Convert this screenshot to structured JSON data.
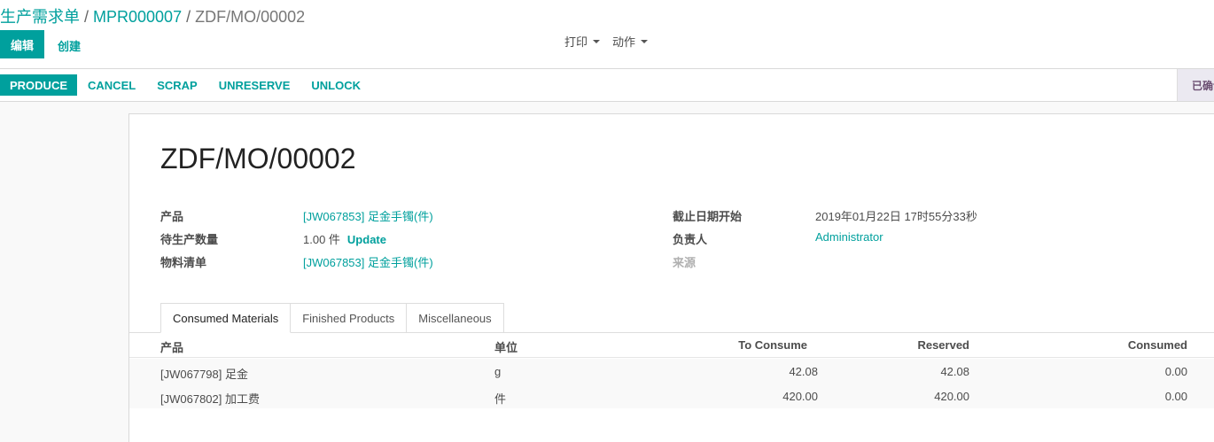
{
  "breadcrumb": {
    "root": "生产需求单",
    "parent": "MPR000007",
    "current": "ZDF/MO/00002",
    "separator": "/"
  },
  "toolbar": {
    "edit_label": "编辑",
    "create_label": "创建",
    "print_label": "打印",
    "action_label": "动作"
  },
  "statusbar": {
    "produce_label": "PRODUCE",
    "cancel_label": "CANCEL",
    "scrap_label": "SCRAP",
    "unreserve_label": "UNRESERVE",
    "unlock_label": "UNLOCK",
    "stage_label": "已确认"
  },
  "record": {
    "title": "ZDF/MO/00002",
    "product_label": "产品",
    "product_value": "[JW067853] 足金手镯(件)",
    "qty_label": "待生产数量",
    "qty_value": "1.00 件",
    "update_label": "Update",
    "bom_label": "物料清单",
    "bom_value": "[JW067853] 足金手镯(件)",
    "deadline_label": "截止日期开始",
    "deadline_value": "2019年01月22日 17时55分33秒",
    "responsible_label": "负责人",
    "responsible_value": "Administrator",
    "source_label": "来源"
  },
  "tabs": [
    "Consumed Materials",
    "Finished Products",
    "Miscellaneous"
  ],
  "table": {
    "headers": {
      "product": "产品",
      "uom": "单位",
      "to_consume": "To Consume",
      "reserved": "Reserved",
      "consumed": "Consumed"
    },
    "rows": [
      {
        "product": "[JW067798] 足金",
        "uom": "g",
        "to_consume": "42.08",
        "reserved": "42.08",
        "consumed": "0.00"
      },
      {
        "product": "[JW067802] 加工费",
        "uom": "件",
        "to_consume": "420.00",
        "reserved": "420.00",
        "consumed": "0.00"
      }
    ]
  },
  "colors": {
    "accent": "#00a09d",
    "stage_bg": "#ebe9f1"
  }
}
